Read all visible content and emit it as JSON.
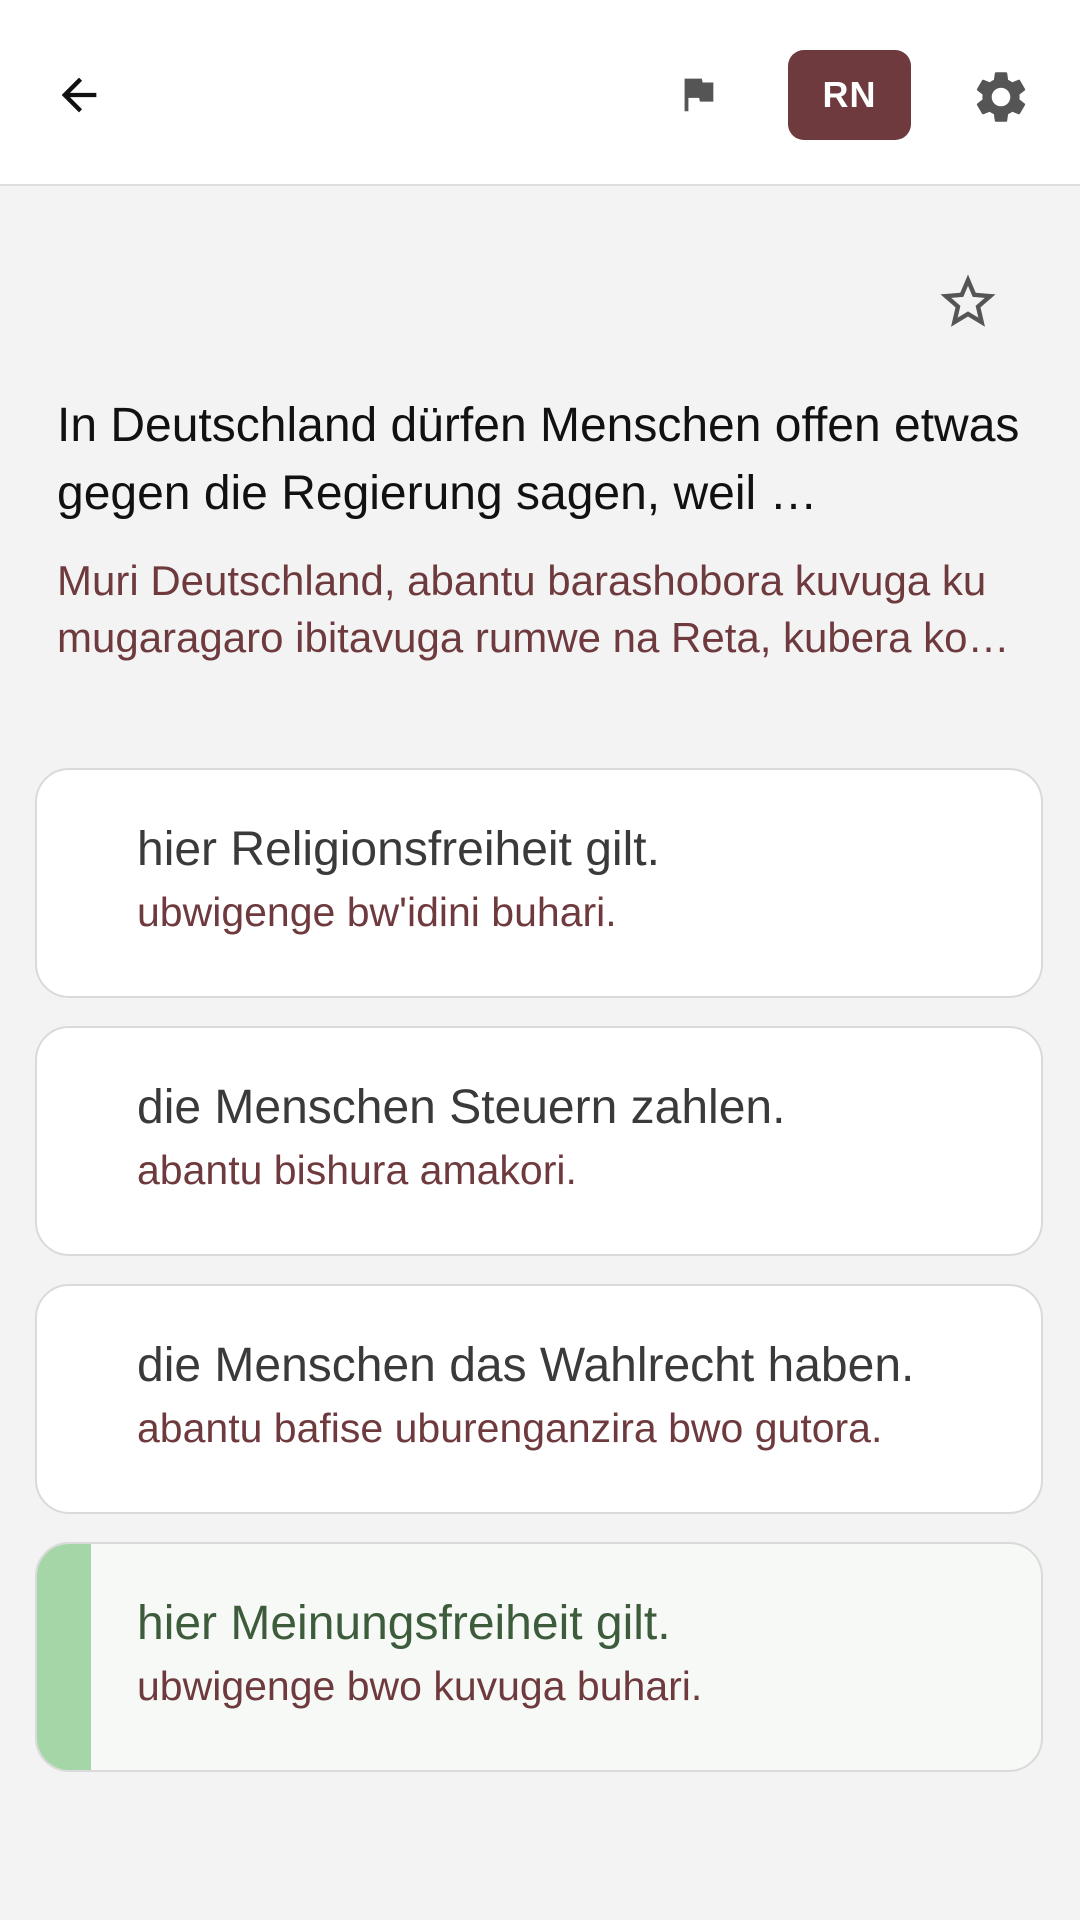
{
  "header": {
    "back_icon": "arrow-back-icon",
    "flag_icon": "flag-icon",
    "language_code": "RN",
    "settings_icon": "gear-icon"
  },
  "question": {
    "favorite_icon": "star-outline-icon",
    "text": "In Deutschland dürfen Menschen offen etwas gegen die Regierung sagen, weil …",
    "translation": "Muri Deutschland, abantu barashobora kuvuga ku mugaragaro ibitavuga rumwe na Reta, kubera ko…"
  },
  "answers": [
    {
      "text": "hier Religionsfreiheit gilt.",
      "translation": "ubwigenge bw'idini buhari.",
      "correct": false
    },
    {
      "text": "die Menschen Steuern zahlen.",
      "translation": "abantu bishura amakori.",
      "correct": false
    },
    {
      "text": "die Menschen das Wahlrecht haben.",
      "translation": "abantu bafise uburenganzira bwo gutora.",
      "correct": false
    },
    {
      "text": "hier Meinungsfreiheit gilt.",
      "translation": "ubwigenge bwo kuvuga buhari.",
      "correct": true
    }
  ],
  "colors": {
    "accent": "#6e3a3e",
    "correct_bar": "#a5d6a7",
    "background": "#f3f3f3"
  }
}
